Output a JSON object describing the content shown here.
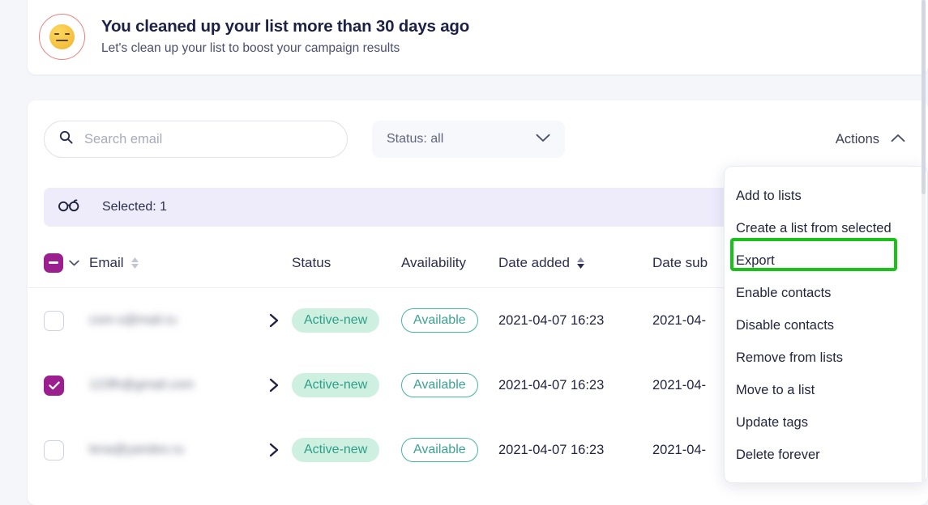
{
  "banner": {
    "icon": "expressionless-face-emoji",
    "ring_color": "#e8837e",
    "title": "You cleaned up your list more than 30 days ago",
    "subtitle": "Let's clean up your list to boost your campaign results"
  },
  "toolbar": {
    "search": {
      "icon": "search-icon",
      "placeholder": "Search email",
      "value": ""
    },
    "status_filter": {
      "label": "Status: all",
      "icon": "chevron-down-icon"
    },
    "actions": {
      "label": "Actions",
      "icon": "chevron-up-icon",
      "expanded": true
    }
  },
  "selection_bar": {
    "icon": "glasses-icon",
    "label": "Selected: 1",
    "background": "#eeecfb"
  },
  "table": {
    "header": {
      "select_all_state": "indeterminate",
      "select_all_color": "#9c1f8f",
      "select_all_chevron": "chevron-down-icon",
      "columns": [
        {
          "label": "Email",
          "sortable": true,
          "sort_active": false
        },
        {
          "label": "Status",
          "sortable": false,
          "sort_active": false
        },
        {
          "label": "Availability",
          "sortable": false,
          "sort_active": false
        },
        {
          "label": "Date added",
          "sortable": true,
          "sort_active": true
        },
        {
          "label": "Date sub",
          "sortable": false,
          "sort_active": false
        }
      ]
    },
    "rows": [
      {
        "selected": false,
        "email": "com-s@mail.ru",
        "email_blurred": true,
        "expand_icon": "chevron-right-icon",
        "status": "Active-new",
        "availability": "Available",
        "date_added": "2021-04-07 16:23",
        "date_subscribed": "2021-04-"
      },
      {
        "selected": true,
        "email": "123fh@gmail.com",
        "email_blurred": true,
        "expand_icon": "chevron-right-icon",
        "status": "Active-new",
        "availability": "Available",
        "date_added": "2021-04-07 16:23",
        "date_subscribed": "2021-04-"
      },
      {
        "selected": false,
        "email": "lena@yandex.ru",
        "email_blurred": true,
        "expand_icon": "chevron-right-icon",
        "status": "Active-new",
        "availability": "Available",
        "date_added": "2021-04-07 16:23",
        "date_subscribed": "2021-04-"
      }
    ]
  },
  "actions_menu": {
    "items": [
      {
        "label": "Add to lists",
        "highlighted": false
      },
      {
        "label": "Create a list from selected",
        "highlighted": false
      },
      {
        "label": "Export",
        "highlighted": true
      },
      {
        "label": "Enable contacts",
        "highlighted": false
      },
      {
        "label": "Disable contacts",
        "highlighted": false
      },
      {
        "label": "Remove from lists",
        "highlighted": false
      },
      {
        "label": "Move to a list",
        "highlighted": false
      },
      {
        "label": "Update tags",
        "highlighted": false
      },
      {
        "label": "Delete forever",
        "highlighted": false
      }
    ],
    "highlight_color": "#18c218"
  },
  "colors": {
    "page_background": "#f4f6fa",
    "card_background": "#ffffff",
    "accent_purple": "#9c1f8f",
    "status_pill_bg": "#cdf0e1",
    "status_pill_text": "#2f9e86",
    "availability_border": "#45b5a4"
  }
}
